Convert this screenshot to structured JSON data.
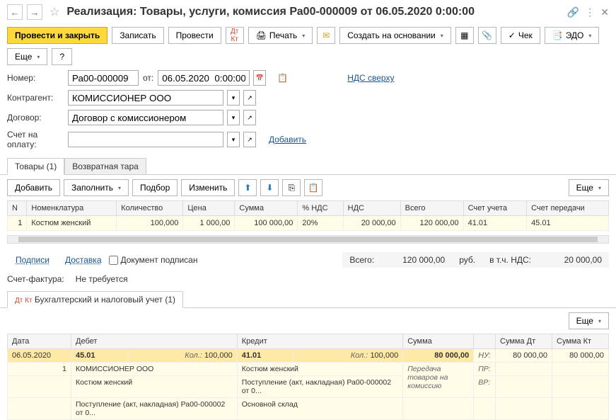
{
  "header": {
    "title": "Реализация: Товары, услуги, комиссия Ра00-000009 от 06.05.2020 0:00:00"
  },
  "toolbar": {
    "postClose": "Провести и закрыть",
    "write": "Записать",
    "post": "Провести",
    "print": "Печать",
    "createBased": "Создать на основании",
    "check": "Чек",
    "edo": "ЭДО",
    "more": "Еще",
    "help": "?"
  },
  "form": {
    "numberLabel": "Номер:",
    "number": "Ра00-000009",
    "fromLabel": "от:",
    "date": "06.05.2020  0:00:00",
    "vatTop": "НДС сверху",
    "counterpartyLabel": "Контрагент:",
    "counterparty": "КОМИССИОНЕР ООО",
    "contractLabel": "Договор:",
    "contract": "Договор с комиссионером",
    "accountLabel": "Счет на оплату:",
    "account": "",
    "addLink": "Добавить"
  },
  "tabs": {
    "goods": "Товары (1)",
    "tare": "Возвратная тара"
  },
  "tabToolbar": {
    "add": "Добавить",
    "fill": "Заполнить",
    "select": "Подбор",
    "edit": "Изменить",
    "more": "Еще"
  },
  "goodsTable": {
    "headers": {
      "n": "N",
      "nomenclature": "Номенклатура",
      "quantity": "Количество",
      "price": "Цена",
      "sum": "Сумма",
      "vatRate": "% НДС",
      "vat": "НДС",
      "total": "Всего",
      "account": "Счет учета",
      "transferAccount": "Счет передачи"
    },
    "row": {
      "n": "1",
      "nomenclature": "Костюм женский",
      "quantity": "100,000",
      "price": "1 000,00",
      "sum": "100 000,00",
      "vatRate": "20%",
      "vat": "20 000,00",
      "total": "120 000,00",
      "account": "41.01",
      "transferAccount": "45.01"
    }
  },
  "footer": {
    "signatures": "Подписи",
    "delivery": "Доставка",
    "docSigned": "Документ подписан",
    "totalLabel": "Всего:",
    "totalValue": "120 000,00",
    "currency": "руб.",
    "vatLabel": "в т.ч. НДС:",
    "vatValue": "20 000,00",
    "invoiceLabel": "Счет-фактура:",
    "invoiceValue": "Не требуется"
  },
  "acctTab": {
    "label": "Бухгалтерский и налоговый учет (1)",
    "more": "Еще"
  },
  "acctTable": {
    "headers": {
      "date": "Дата",
      "debit": "Дебет",
      "credit": "Кредит",
      "sum": "Сумма",
      "sumDt": "Сумма Дт",
      "sumKt": "Сумма Кт"
    },
    "row1": {
      "date": "06.05.2020",
      "debitAcc": "45.01",
      "qtyLbl": "Кол.:",
      "debitQty": "100,000",
      "creditAcc": "41.01",
      "creditQty": "100,000",
      "sum": "80 000,00",
      "nu": "НУ:",
      "sumDt": "80 000,00",
      "sumKt": "80 000,00"
    },
    "row2": {
      "n": "1",
      "party": "КОМИССИОНЕР ООО",
      "item": "Костюм женский",
      "desc": "Передача товаров на комиссию",
      "pr": "ПР:"
    },
    "row3": {
      "item": "Костюм женский",
      "receipt": "Поступление (акт, накладная) Ра00-000002 от 0...",
      "vr": "ВР:"
    },
    "row4": {
      "receipt": "Поступление (акт, накладная) Ра00-000002 от 0...",
      "warehouse": "Основной склад"
    }
  }
}
